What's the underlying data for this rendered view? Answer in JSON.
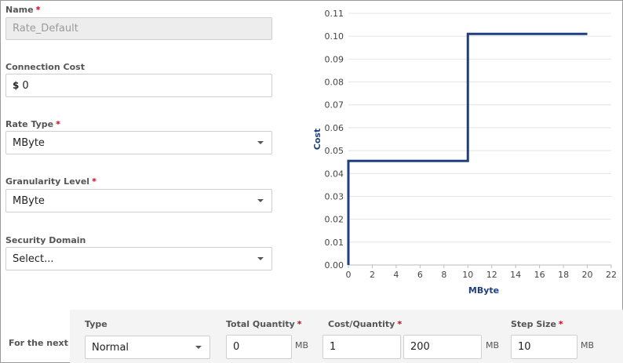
{
  "form": {
    "name": {
      "label": "Name",
      "value": "Rate_Default"
    },
    "connection_cost": {
      "label": "Connection Cost",
      "currency": "$",
      "value": "0"
    },
    "rate_type": {
      "label": "Rate Type",
      "value": "MByte"
    },
    "granularity": {
      "label": "Granularity Level",
      "value": "MByte"
    },
    "security_domain": {
      "label": "Security Domain",
      "value": "Select..."
    },
    "required_mark": "*"
  },
  "step_row": {
    "row_label": "For the next",
    "type": {
      "label": "Type",
      "value": "Normal"
    },
    "total_quantity": {
      "label": "Total Quantity",
      "value": "0",
      "unit": "MB"
    },
    "cost_quantity": {
      "label": "Cost/Quantity",
      "cost": "1",
      "quantity": "200",
      "unit": "MB"
    },
    "step_size": {
      "label": "Step Size",
      "value": "10",
      "unit": "MB"
    }
  },
  "chart_data": {
    "type": "line",
    "step": true,
    "xlabel": "MByte",
    "ylabel": "Cost",
    "xlim": [
      0,
      22
    ],
    "ylim": [
      0,
      0.11
    ],
    "x_ticks": [
      "0",
      "2",
      "4",
      "6",
      "8",
      "10",
      "12",
      "14",
      "16",
      "18",
      "20",
      "22"
    ],
    "y_ticks": [
      "0.00",
      "0.01",
      "0.02",
      "0.03",
      "0.04",
      "0.05",
      "0.06",
      "0.07",
      "0.08",
      "0.09",
      "0.10",
      "0.11"
    ],
    "grid": true,
    "series": [
      {
        "points": [
          [
            0,
            0
          ],
          [
            0,
            0.0455
          ],
          [
            10,
            0.0455
          ],
          [
            10,
            0.101
          ],
          [
            20,
            0.101
          ]
        ],
        "color": "#1f3f80"
      }
    ]
  }
}
